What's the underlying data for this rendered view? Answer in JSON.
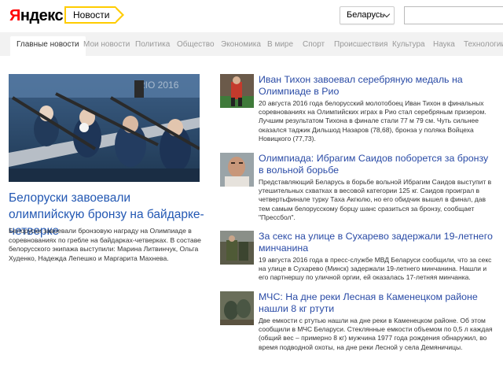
{
  "header": {
    "logo_first": "Я",
    "logo_rest": "ндекс",
    "service": "Новости",
    "region": "Беларусь"
  },
  "tabs": [
    "Главные новости",
    "Мои новости",
    "Политика",
    "Общество",
    "Экономика",
    "В мире",
    "Спорт",
    "Происшествия",
    "Культура",
    "Наука",
    "Технологии"
  ],
  "lead": {
    "image_label": "RIO 2016",
    "title": "Белоруски завоевали олимпийскую бронзу на байдарке-четверке",
    "text": "Белоруски завоевали бронзовую награду на Олимпиаде в соревнованиях по гребле на байдарках-четверках. В составе белорусского экипажа выступили: Марина Литвинчук, Ольга Худенко, Надежда Лепешко и Маргарита Махнева."
  },
  "items": [
    {
      "title": "Иван Тихон завоевал серебряную медаль на Олимпиаде в Рио",
      "text": "20 августа 2016 года белорусский молотобоец Иван Тихон в финальных соревнованиях на Олимпийских играх в Рио стал серебряным призером. Лучшим результатом Тихона в финале стали 77 м 79 см. Чуть сильнее оказался таджик Дильшод Назаров (78,68), бронза у поляка Войцеха Новицкого (77,73)."
    },
    {
      "title": "Олимпиада: Ибрагим Саидов поборется за бронзу в вольной борьбе",
      "text": "Представляющий Беларусь в борьбе вольной Ибрагим Саидов выступит в утешительных схватках в весовой категории 125 кг. Саидов проиграл в четвертьфинале турку Таха Акгюлю, но его обидчик вышел в финал, дав тем самым белорусскому борцу шанс сразиться за бронзу, сообщает \"Прессбол\"."
    },
    {
      "title": "За секс на улице в Сухарево задержали 19-летнего минчанина",
      "text": "19 августа 2016 года в пресс-службе МВД Беларуси сообщили, что за секс на улице в Сухарево (Минск) задержали 19-летнего минчанина. Нашли и его партнершу по уличной оргии, ей оказалась 17-летняя минчанка."
    },
    {
      "title": "МЧС: На дне реки Лесная в Каменецком районе нашли 8 кг ртути",
      "text": "Две емкости с ртутью нашли на дне реки в Каменецком районе. Об этом сообщили в МЧС Беларуси. Стеклянные емкости объемом по 0,5 л каждая (общий вес – примерно 8 кг) мужчина 1977 года рождения обнаружил, во время подводной охоты, на дне реки Лесной у села Демяничицы."
    }
  ],
  "colors": {
    "link": "#2a4ba6",
    "logo_red": "#ff0000",
    "accent_yellow": "#ffcc00"
  }
}
